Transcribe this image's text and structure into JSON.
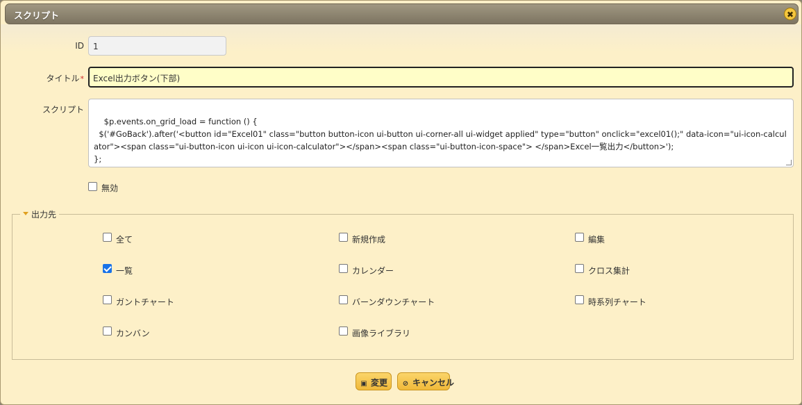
{
  "dialog": {
    "title": "スクリプト",
    "close_icon": "×"
  },
  "form": {
    "id_label": "ID",
    "id_value": "1",
    "title_label": "タイトル",
    "required_mark": "*",
    "title_value": "Excel出力ボタン(下部)",
    "script_label": "スクリプト",
    "script_value": "$p.events.on_grid_load = function () {\n  $('#GoBack').after('<button id=\"Excel01\" class=\"button button-icon ui-button ui-corner-all ui-widget applied\" type=\"button\" onclick=\"excel01();\" data-icon=\"ui-icon-calculator\"><span class=\"ui-button-icon ui-icon ui-icon-calculator\"></span><span class=\"ui-button-icon-space\"> </span>Excel一覧出力</button>');\n};",
    "disabled_label": "無効",
    "disabled_checked": false
  },
  "output": {
    "legend": "出力先",
    "options": [
      {
        "label": "全て",
        "checked": false
      },
      {
        "label": "新規作成",
        "checked": false
      },
      {
        "label": "編集",
        "checked": false
      },
      {
        "label": "一覧",
        "checked": true
      },
      {
        "label": "カレンダー",
        "checked": false
      },
      {
        "label": "クロス集計",
        "checked": false
      },
      {
        "label": "ガントチャート",
        "checked": false
      },
      {
        "label": "バーンダウンチャート",
        "checked": false
      },
      {
        "label": "時系列チャート",
        "checked": false
      },
      {
        "label": "カンバン",
        "checked": false
      },
      {
        "label": "画像ライブラリ",
        "checked": false
      }
    ]
  },
  "buttons": {
    "save_label": "変更",
    "save_icon": "floppy-disk-icon",
    "cancel_label": "キャンセル",
    "cancel_icon": "cancel-circle-icon"
  },
  "colors": {
    "background": "#fdf0c8",
    "title_input_bg": "#fffec8",
    "button_bg": "#f0b93a",
    "checkbox_checked": "#1a73e8"
  }
}
